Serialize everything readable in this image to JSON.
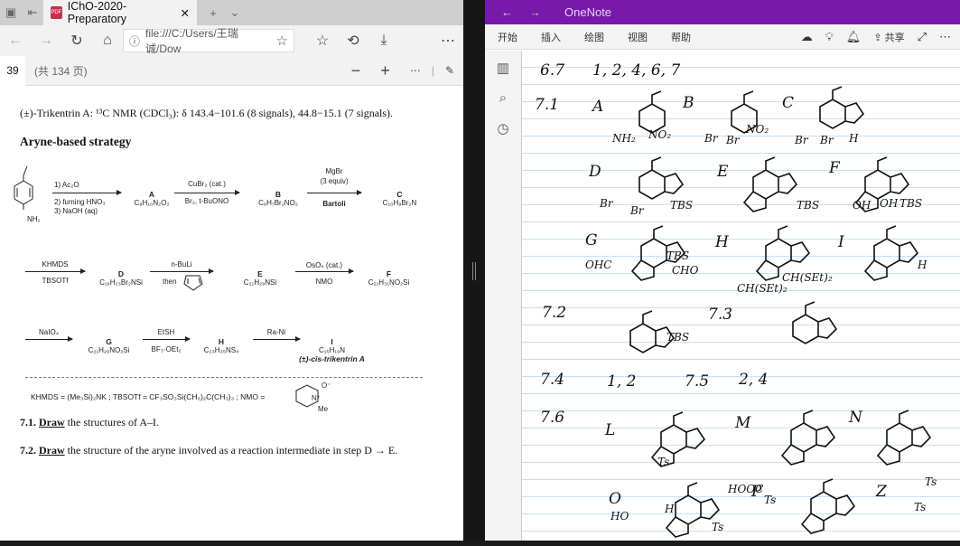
{
  "browser": {
    "tab_title": "IChO-2020-Preparatory",
    "address": "file:///C:/Users/王瑞诚/Dow",
    "page_number": "39",
    "page_total": "(共 134 页)"
  },
  "document": {
    "line1": "(±)-Trikentrin A: ¹³C NMR (CDCl₃): δ 143.4−101.6 (8 signals), 44.8−15.1 (7 signals).",
    "heading": "Aryne-based strategy",
    "scheme": {
      "start": "NH₂",
      "r1": [
        "1) Ac₂O",
        "2) fuming HNO₃",
        "3) NaOH (aq)"
      ],
      "A": {
        "label": "A",
        "formula": "C₈H₁₀N₂O₂"
      },
      "r2": [
        "CuBr₂ (cat.)",
        "Br₂, t-BuONO"
      ],
      "B": {
        "label": "B",
        "formula": "C₈H₇Br₂NO₂"
      },
      "r3": [
        "MgBr",
        "(3 equiv)",
        "Bartoli"
      ],
      "C": {
        "label": "C",
        "formula": "C₁₀H₉Br₂N"
      },
      "r4": [
        "KHMDS",
        "TBSOTf"
      ],
      "D": {
        "label": "D",
        "formula": "C₁₆H₂₃Br₂NSi"
      },
      "r5": [
        "n-BuLi",
        "then"
      ],
      "E": {
        "label": "E",
        "formula": "C₂₁H₂₉NSi"
      },
      "r6": [
        "OsO₄ (cat.)",
        "NMO"
      ],
      "F": {
        "label": "F",
        "formula": "C₂₁H₃₁NO₂Si"
      },
      "r7": [
        "NaIO₄"
      ],
      "G": {
        "label": "G",
        "formula": "C₂₁H₂₉NO₂Si"
      },
      "r8": [
        "EtSH",
        "BF₃·OEt₂"
      ],
      "H": {
        "label": "H",
        "formula": "C₂₃H₃₅NS₄"
      },
      "r9": [
        "Ra-Ni"
      ],
      "I": {
        "label": "I",
        "formula": "C₁₅H₁₉N",
        "name": "(±)-cis-trikentrin A"
      }
    },
    "footnote": "KHMDS = (Me₃Si)₂NK ; TBSOTf = CF₃SO₃Si(CH₃)₂C(CH₃)₃ ; NMO =",
    "nmo_labels": [
      "O⁻",
      "N⁺",
      "Me"
    ],
    "q71": {
      "num": "7.1.",
      "verb": "Draw",
      "rest": "the structures of A–I."
    },
    "q72": {
      "num": "7.2.",
      "verb": "Draw",
      "rest": "the structure of the aryne involved as a reaction intermediate in step D → E."
    }
  },
  "onenote": {
    "title": "OneNote",
    "menu": [
      "开始",
      "插入",
      "绘图",
      "视图",
      "帮助"
    ],
    "share": "共享",
    "notes": {
      "n67": "6.7",
      "n67v": "1, 2, 4, 6, 7",
      "n71": "7.1",
      "A": "A",
      "B": "B",
      "C": "C",
      "D": "D",
      "E": "E",
      "F": "F",
      "G": "G",
      "H": "H",
      "I": "I",
      "n72": "7.2",
      "n73": "7.3",
      "n74": "7.4",
      "n74v": "1, 2",
      "n75": "7.5",
      "n75v": "2, 4",
      "n76": "7.6",
      "L": "L",
      "M": "M",
      "N": "N",
      "O": "O",
      "P": "P",
      "Z": "Z",
      "sub": [
        "NH₂",
        "NO₂",
        "Br",
        "Br",
        "NO₂",
        "Br",
        "Br",
        "H",
        "Br",
        "Br",
        "TBS",
        "TBS",
        "OH",
        "OH",
        "TBS",
        "OHC",
        "TBS",
        "CHO",
        "CH(SEt)₂",
        "CH(SEt)₂",
        "H",
        "TBS",
        "HOOC",
        "Ts",
        "Ts",
        "HO",
        "H",
        "Ts",
        "Ts",
        "Ts"
      ]
    }
  }
}
